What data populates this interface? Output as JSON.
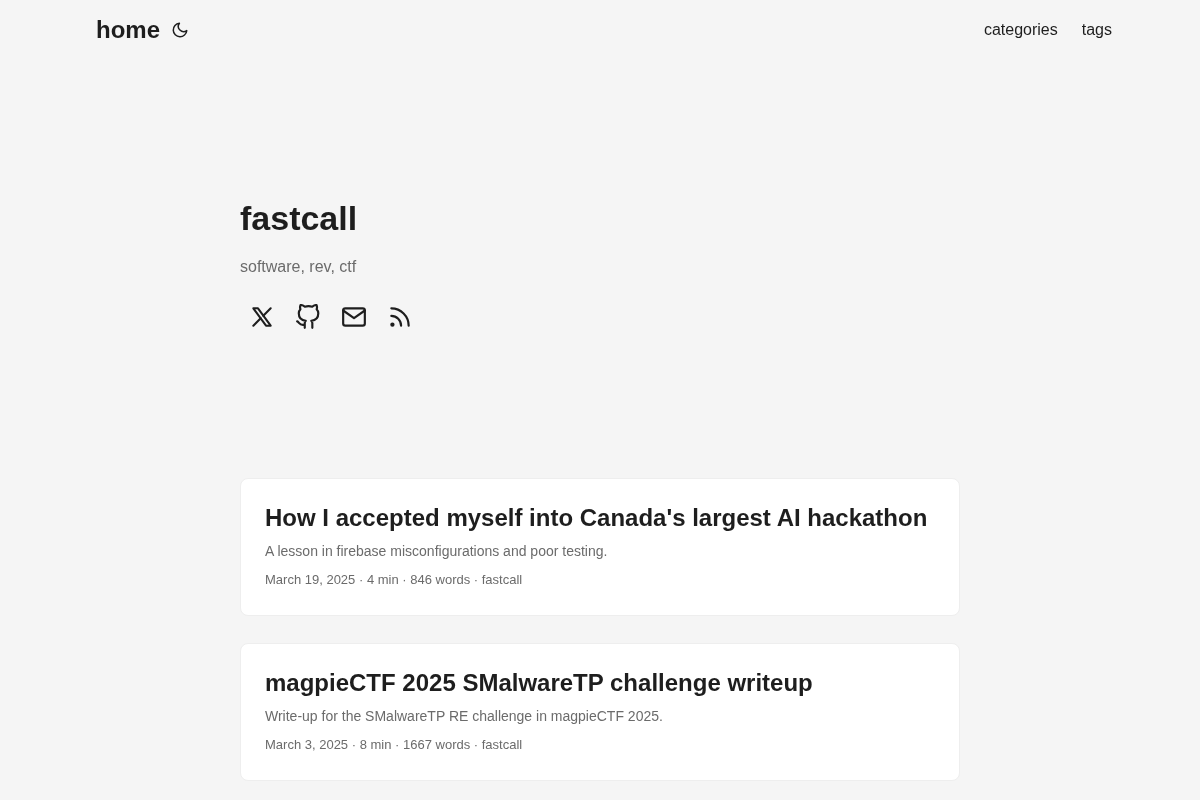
{
  "header": {
    "logo": "home",
    "nav": [
      "categories",
      "tags"
    ]
  },
  "profile": {
    "title": "fastcall",
    "subtitle": "software, rev, ctf"
  },
  "posts": [
    {
      "title": "How I accepted myself into Canada's largest AI hackathon",
      "description": "A lesson in firebase misconfigurations and poor testing.",
      "meta": "March 19, 2025 · 4 min · 846 words · fastcall"
    },
    {
      "title": "magpieCTF 2025 SMalwareTP challenge writeup",
      "description": "Write-up for the SMalwareTP RE challenge in magpieCTF 2025.",
      "meta": "March 3, 2025 · 8 min · 1667 words · fastcall"
    }
  ]
}
